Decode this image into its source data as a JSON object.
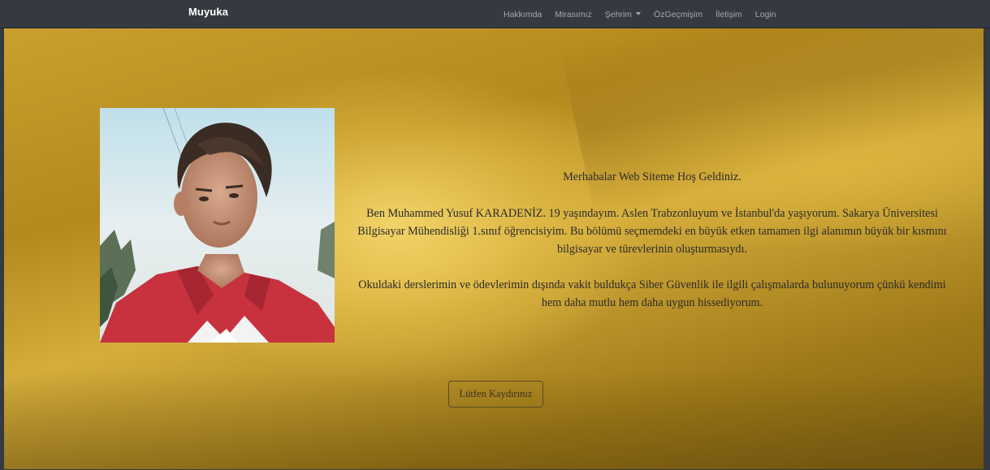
{
  "navbar": {
    "brand": "Muyuka",
    "links": [
      {
        "label": "Hakkımda"
      },
      {
        "label": "Mirasımız"
      },
      {
        "label": "Şehrim",
        "dropdown": true
      },
      {
        "label": "ÖzGeçmişim"
      },
      {
        "label": "İletişim"
      },
      {
        "label": "Login"
      }
    ]
  },
  "hero": {
    "greeting": "Merhabalar Web Siteme Hoş Geldiniz.",
    "paragraph_1": "Ben Muhammed Yusuf KARADENİZ. 19 yaşındayım. Aslen Trabzonluyum ve İstanbul'da yaşıyorum. Sakarya Üniversitesi Bilgisayar Mühendisliği 1.sınıf öğrencisiyim. Bu bölümü seçmemdeki en büyük etken tamamen ilgi alanımın büyük bir kısmını bilgisayar ve türevlerinin oluşturmasıydı.",
    "paragraph_2": "Okuldaki derslerimin ve ödevlerimin dışında vakit buldukça Siber Güvenlik ile ilgili çalışmalarda bulunuyorum çünkü kendimi hem daha mutlu hem daha uygun hissediyorum.",
    "cta_label": "Lütfen Kaydırınız"
  },
  "colors": {
    "navbar_bg": "#343a40",
    "hero_gold": "#c9a02f",
    "text": "#2b2b2b"
  },
  "icons": {
    "dropdown": "caret-down-icon"
  }
}
